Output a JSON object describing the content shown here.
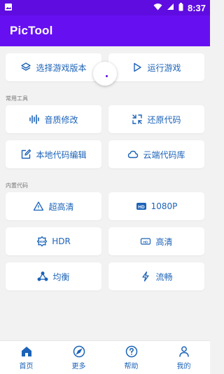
{
  "status_bar": {
    "time": "8:37"
  },
  "app": {
    "title": "PicTool"
  },
  "top_buttons": [
    {
      "label": "选择游戏版本",
      "icon": "layers-icon"
    },
    {
      "label": "运行游戏",
      "icon": "play-icon"
    }
  ],
  "sections": [
    {
      "label": "常用工具",
      "buttons": [
        {
          "label": "音质修改",
          "icon": "waveform-icon"
        },
        {
          "label": "还原代码",
          "icon": "restore-icon"
        },
        {
          "label": "本地代码编辑",
          "icon": "edit-icon"
        },
        {
          "label": "云端代码库",
          "icon": "cloud-icon"
        }
      ]
    },
    {
      "label": "内置代码",
      "buttons": [
        {
          "label": "超高清",
          "icon": "warning-icon"
        },
        {
          "label": "1080P",
          "icon": "hd-icon"
        },
        {
          "label": "HDR",
          "icon": "hdr-icon"
        },
        {
          "label": "高清",
          "icon": "hd-small-icon"
        },
        {
          "label": "均衡",
          "icon": "balance-icon"
        },
        {
          "label": "流畅",
          "icon": "flash-icon"
        }
      ]
    }
  ],
  "bottom_nav": [
    {
      "label": "首页",
      "icon": "home-icon"
    },
    {
      "label": "更多",
      "icon": "compass-icon"
    },
    {
      "label": "帮助",
      "icon": "help-icon"
    },
    {
      "label": "我的",
      "icon": "person-icon"
    }
  ],
  "colors": {
    "primary": "#6610f2",
    "status_bar": "#5e0ce0",
    "accent": "#1c63b8",
    "background": "#f2f2f2"
  }
}
